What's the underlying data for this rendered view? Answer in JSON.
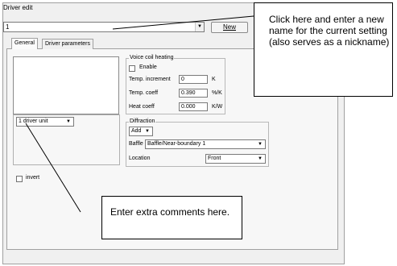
{
  "window": {
    "title": "Driver edit"
  },
  "name_field": {
    "value": "1"
  },
  "buttons": {
    "new": "New"
  },
  "tabs": [
    {
      "label": "General"
    },
    {
      "label": "Driver parameters"
    }
  ],
  "units_select": {
    "value": "1 driver unit"
  },
  "voice_coil": {
    "group_label": "Voice coil heating",
    "enable_label": "Enable",
    "temp_increment": {
      "label": "Temp. increment",
      "value": "0",
      "unit": "K"
    },
    "temp_coeff": {
      "label": "Temp. coeff",
      "value": "0.390",
      "unit": "%/K"
    },
    "heat_coeff": {
      "label": "Heat coeff",
      "value": "0.000",
      "unit": "K/W"
    }
  },
  "diffraction": {
    "group_label": "Diffraction",
    "add_label": "Add",
    "baffle_label": "Baffle",
    "baffle_value": "Baffle/Near-boundary 1",
    "location_label": "Location",
    "location_value": "Front"
  },
  "invert_label": "invert",
  "callouts": {
    "top": "Click here and enter a new name for the current setting (also serves as a nickname)",
    "bottom": "Enter extra comments here."
  }
}
